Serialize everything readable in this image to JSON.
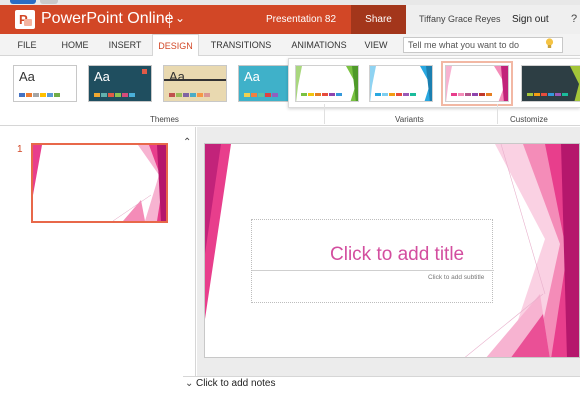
{
  "app": {
    "name": "PowerPoint Online",
    "logo_letter": "P",
    "document_title": "Presentation 82",
    "share_label": "Share",
    "user_name": "Tiffany Grace Reyes",
    "sign_out_label": "Sign out",
    "help_label": "?",
    "accent_color": "#d24726"
  },
  "ribbon": {
    "tabs": [
      {
        "label": "FILE",
        "active": false
      },
      {
        "label": "HOME",
        "active": false
      },
      {
        "label": "INSERT",
        "active": false
      },
      {
        "label": "DESIGN",
        "active": true
      },
      {
        "label": "TRANSITIONS",
        "active": false
      },
      {
        "label": "ANIMATIONS",
        "active": false
      },
      {
        "label": "VIEW",
        "active": false
      }
    ],
    "tell_me_placeholder": "Tell me what you want to do",
    "themes": [
      {
        "label": "Aa",
        "background": "#ffffff",
        "text_color": "#333333",
        "dots": [
          "#4472c4",
          "#ed7d31",
          "#a5a5a5",
          "#ffc000",
          "#5b9bd5",
          "#70ad47"
        ]
      },
      {
        "label": "Aa",
        "background": "#1f4e5f",
        "text_color": "#ffffff",
        "dots": [
          "#f0a830",
          "#62b0ae",
          "#e05a47",
          "#8cc152",
          "#d44b7b",
          "#4ab0d9"
        ]
      },
      {
        "label": "Aa",
        "background": "#e9d9b0",
        "text_color": "#333333",
        "dots": [
          "#c0504d",
          "#9bbb59",
          "#8064a2",
          "#4bacc6",
          "#f79646",
          "#d99694"
        ]
      },
      {
        "label": "Aa",
        "background": "#3fb1c9",
        "text_color": "#ffffff",
        "dots": [
          "#f0d050",
          "#f08040",
          "#60c0a0",
          "#e04040",
          "#9060c0",
          "#ffffff"
        ]
      }
    ],
    "variants": [
      {
        "accent": "#7ac142",
        "dots": [
          "#7ac142",
          "#f1c40f",
          "#e67e22",
          "#e74c3c",
          "#8e44ad",
          "#3498db"
        ],
        "selected": false
      },
      {
        "accent": "#29a8e0",
        "dots": [
          "#29a8e0",
          "#7dcef0",
          "#f39c12",
          "#e74c3c",
          "#9b59b6",
          "#1abc9c"
        ],
        "selected": false
      },
      {
        "accent": "#e83e8c",
        "dots": [
          "#e83e8c",
          "#f48cb8",
          "#b5558c",
          "#8e44ad",
          "#c0392b",
          "#e67e22"
        ],
        "selected": true
      },
      {
        "accent": "#2d3e44",
        "dots": [
          "#a4c639",
          "#f39c12",
          "#e74c3c",
          "#3498db",
          "#9b59b6",
          "#1abc9c"
        ],
        "selected": false
      }
    ],
    "groups": {
      "themes": "Themes",
      "variants": "Variants",
      "customize": "Customize"
    }
  },
  "slides": {
    "items": [
      {
        "number": "1"
      }
    ],
    "theme_color": "#e83e8c"
  },
  "slide_editor": {
    "title_placeholder": "Click to add title",
    "subtitle_placeholder": "Click to add subtitle"
  },
  "notes": {
    "placeholder": "Click to add notes"
  }
}
